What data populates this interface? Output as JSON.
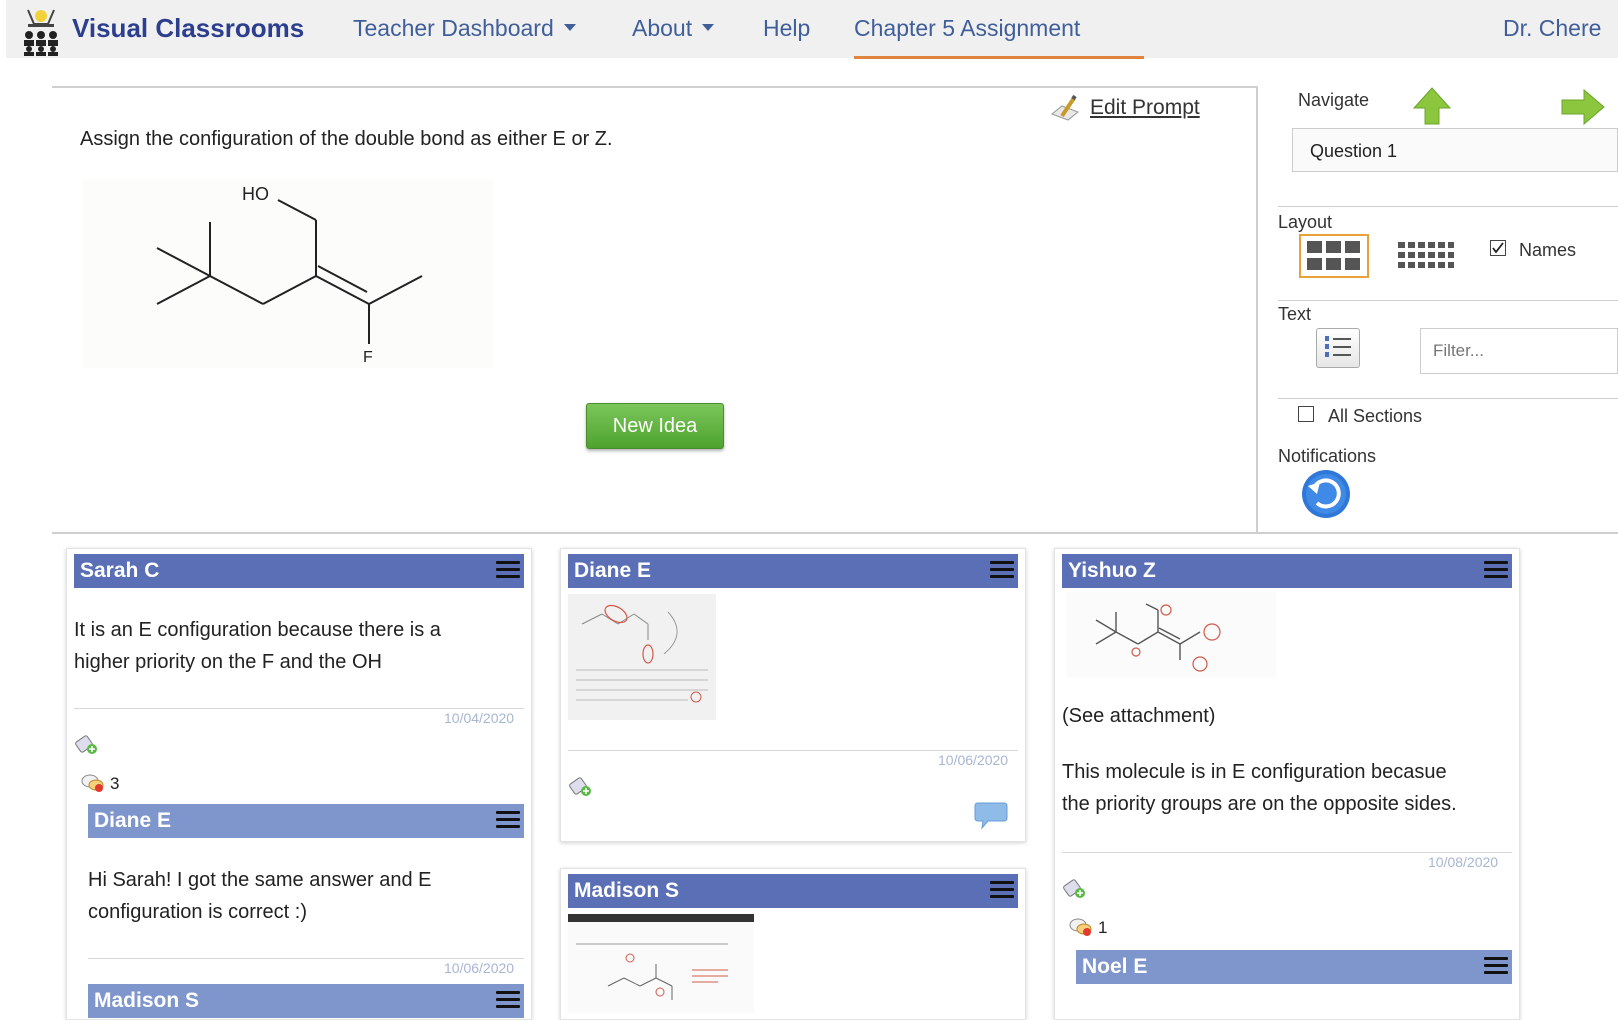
{
  "navbar": {
    "brand": "Visual Classrooms",
    "items": [
      {
        "label": "Teacher Dashboard",
        "dropdown": true
      },
      {
        "label": "About",
        "dropdown": true
      },
      {
        "label": "Help",
        "dropdown": false
      },
      {
        "label": "Chapter 5 Assignment",
        "dropdown": false,
        "active": true
      }
    ],
    "user": "Dr. Chere"
  },
  "prompt": {
    "edit_label": "Edit Prompt",
    "question": "Assign the configuration of the double bond as either E or Z.",
    "molecule_labels": {
      "oh": "HO",
      "f": "F"
    },
    "new_idea_label": "New Idea"
  },
  "sidebar": {
    "navigate_label": "Navigate",
    "question_select": "Question 1",
    "layout_label": "Layout",
    "names_label": "Names",
    "names_checked": true,
    "text_label": "Text",
    "filter_placeholder": "Filter...",
    "all_sections_label": "All Sections",
    "all_sections_checked": false,
    "notifications_label": "Notifications"
  },
  "cards": {
    "sarah": {
      "author": "Sarah C",
      "text_line1": "It is an E configuration because there is a",
      "text_line2": "higher priority on the F and the OH",
      "date": "10/04/2020",
      "comment_count": "3",
      "reply": {
        "author": "Diane E",
        "text_line1": "Hi Sarah! I got the same answer and E",
        "text_line2": "configuration is correct :)",
        "date": "10/06/2020"
      },
      "reply2_author": "Madison S"
    },
    "diane": {
      "author": "Diane E",
      "date": "10/06/2020"
    },
    "madison": {
      "author": "Madison S"
    },
    "yishuo": {
      "author": "Yishuo Z",
      "text_attachment": "(See attachment)",
      "text_line1": "This molecule is in E configuration becasue",
      "text_line2": "the priority groups are on the opposite sides.",
      "date": "10/08/2020",
      "comment_count": "1",
      "reply_author": "Noel E"
    }
  },
  "colors": {
    "header_main": "#5a6fb5",
    "header_reply": "#7f96cc",
    "active_tab_underline": "#e0843e",
    "new_idea_green": "#5cb33b",
    "nav_link": "#3f5e9a"
  }
}
